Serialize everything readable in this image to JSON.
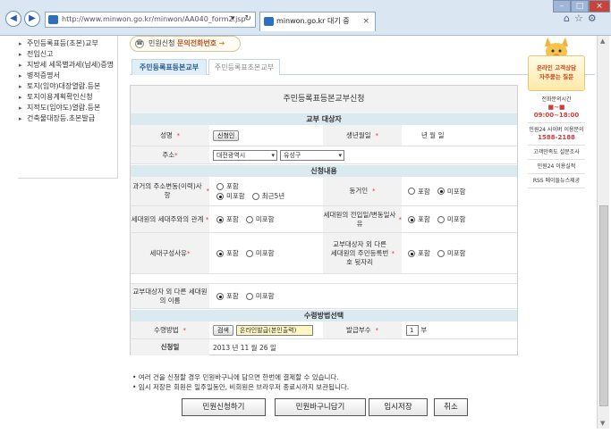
{
  "browser": {
    "url": "http://www.minwon.go.kr/minwon/AA040_form2.jsp",
    "address_tools": "▾ ↻",
    "tab_title": "minwon.go.kr 대기 중",
    "tab_close": "×",
    "back_glyph": "◀",
    "forward_glyph": "▶",
    "min_glyph": "–",
    "max_glyph": "□",
    "close_glyph": "×",
    "tool_icons": "⌂☆⚙"
  },
  "leftnav": {
    "items": [
      "주민등록표등(초본)교부",
      "전입신고",
      "지방세 세목별과세(납세)증명",
      "병적증명서",
      "토지(임야)대장열람.등본",
      "토지이용계획확인신청",
      "지적도(임야도)열람.등본",
      "건축물대장등.초본발급"
    ]
  },
  "banner": {
    "prefix": "민원신청",
    "highlight": "문의전화번호",
    "arrow": "➔"
  },
  "tabs": [
    "주민등록표등본교부",
    "주민등록표초본교부"
  ],
  "form": {
    "title": "주민등록표등본교부신청",
    "section_recipient": "교부 대상자",
    "name_label": "성명",
    "name_button": "신청인",
    "birth_label": "생년월일",
    "birth_units": "년    월    일",
    "address_label": "주소",
    "address_city": "대전광역시",
    "address_district": "유성구",
    "section_content": "신청내용",
    "history_label": "과거의 주소변동(이력)사항",
    "history_opt1": "포함",
    "history_opt2": "미포함",
    "history_opt3": "최근5년",
    "cohabitant_label": "동거인",
    "cohabitant_opt1": "포함",
    "cohabitant_opt2": "미포함",
    "relation_label": "세대원의 세대주와의 관계",
    "relation_opt1": "포함",
    "relation_opt2": "미포함",
    "movein_label": "세대원의 전입일/변동일사유",
    "movein_opt1": "포함",
    "movein_opt2": "미포함",
    "compose_label": "세대구성사유",
    "compose_opt1": "포함",
    "compose_opt2": "미포함",
    "otherfamily_label": "교부대상자 외 다른 세대원의 주민등록번호 뒷자리",
    "otherfamily_opt1": "포함",
    "otherfamily_opt2": "미포함",
    "membername_label": "교부대상자 외 다른 세대원의 이름",
    "membername_opt1": "포함",
    "membername_opt2": "미포함",
    "section_receive": "수령방법선택",
    "receive_label": "수령방법",
    "receive_search": "검색",
    "receive_value": "온라인발급(본인출력)",
    "copies_label": "발급부수",
    "copies_value": "1",
    "copies_unit": "부",
    "date_label": "신청일",
    "date_value": "2013  년    11  월    26  일",
    "required_mark": "*"
  },
  "notes": [
    "• 여러 건을 신청할 경우 민원바구니에 담으면 한번에 결제할 수 있습니다.",
    "• 임시 저장은 회원은 일주일동안, 비회원은 브라우저 종료시까지 보관됩니다."
  ],
  "buttons": {
    "apply": "민원신청하기",
    "basket": "민원바구니담기",
    "temp_save": "임시저장",
    "cancel": "취소"
  },
  "side": {
    "box_line1": "온라인 고객상담",
    "box_line2": "자주묻는 질문",
    "items": [
      {
        "label": "전화문의시간",
        "sub": "■~■ 09:00~18:00"
      },
      {
        "label": "민원24 사이버 이용문의",
        "sub": "1588-2188"
      },
      {
        "label": "고객만족도 설문조사",
        "sub": ""
      },
      {
        "label": "민원24 이용실적",
        "sub": ""
      },
      {
        "label": "RSS 메이들뉴스제공",
        "sub": ""
      }
    ]
  },
  "scrollbar": {
    "up_glyph": "▲",
    "down_glyph": "▼"
  },
  "colors": {
    "section_bg": "#dbe9f1",
    "label_bg": "#f2f2f2",
    "required": "#d23c3c",
    "highlight": "#c0572a"
  }
}
